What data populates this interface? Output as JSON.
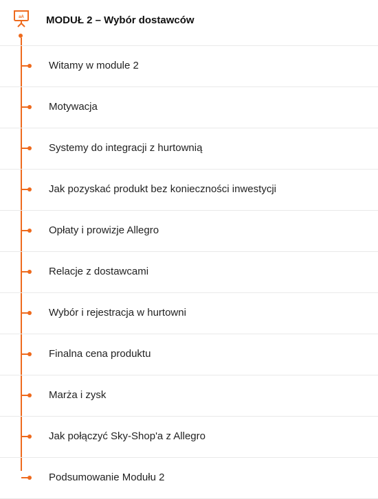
{
  "module": {
    "title": "MODUŁ 2 – Wybór dostawców",
    "icon": "presentation-board-icon",
    "accent_color": "#ee6a1d"
  },
  "lessons": [
    {
      "label": "Witamy w module 2"
    },
    {
      "label": "Motywacja"
    },
    {
      "label": "Systemy do integracji z hurtownią"
    },
    {
      "label": "Jak pozyskać produkt bez konieczności inwestycji"
    },
    {
      "label": "Opłaty i prowizje Allegro"
    },
    {
      "label": "Relacje z dostawcami"
    },
    {
      "label": "Wybór i rejestracja w hurtowni"
    },
    {
      "label": "Finalna cena produktu"
    },
    {
      "label": "Marża i zysk"
    },
    {
      "label": "Jak połączyć Sky-Shop'a z Allegro"
    },
    {
      "label": "Podsumowanie Modułu 2"
    }
  ]
}
